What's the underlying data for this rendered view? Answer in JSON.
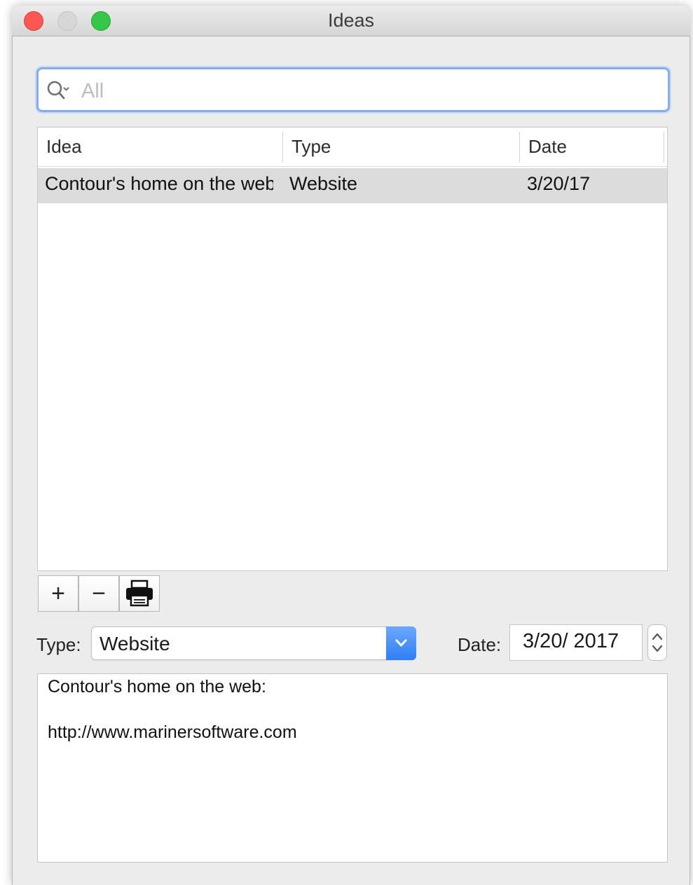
{
  "window": {
    "title": "Ideas"
  },
  "search": {
    "placeholder": "All",
    "value": ""
  },
  "table": {
    "columns": [
      "Idea",
      "Type",
      "Date"
    ],
    "rows": [
      {
        "idea": "Contour's home on the web:",
        "type": "Website",
        "date": "3/20/17"
      }
    ]
  },
  "toolbar": {
    "add_label": "+",
    "remove_label": "−"
  },
  "detail": {
    "type_label": "Type:",
    "type_value": "Website",
    "date_label": "Date:",
    "date_value": "3/20/ 2017"
  },
  "notes": {
    "lines": [
      "Contour's home on the web:",
      "",
      "http://www.marinersoftware.com"
    ]
  },
  "colors": {
    "close": "#fc5753",
    "minimize_disabled": "#d7d7d7",
    "zoom": "#34c748",
    "focus_ring": "#86acea",
    "popup_accent": "#2f7ef6",
    "selected_row": "#dcdcdc"
  },
  "icons": [
    "search-icon",
    "chevron-down-icon",
    "printer-icon",
    "stepper-arrows-icon"
  ]
}
